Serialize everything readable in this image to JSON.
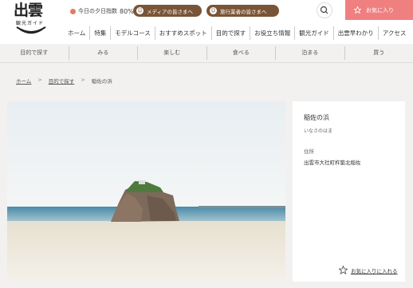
{
  "logo": {
    "main": "出雲",
    "sub": "観光ガイド"
  },
  "header": {
    "sunset_label": "今日の夕日指数",
    "sunset_value": "80%",
    "media_button": "メディアの皆さまへ",
    "travel_button": "旅行業者の皆さまへ",
    "favorites_button": "お気に入り"
  },
  "nav": {
    "items": [
      "ホーム",
      "特集",
      "モデルコース",
      "おすすめスポット",
      "目的で探す",
      "お役立ち情報",
      "観光ガイド",
      "出雲早わかり",
      "アクセス"
    ]
  },
  "subnav": {
    "items": [
      "目的で探す",
      "みる",
      "楽しむ",
      "食べる",
      "泊まる",
      "買う"
    ]
  },
  "breadcrumb": {
    "home": "ホーム",
    "category": "目的で探す",
    "current": "稲佐の浜"
  },
  "spot": {
    "name": "稲佐の浜",
    "kana": "いなさのはま",
    "address_label": "住所",
    "address": "出雲市大社町杵築北稲佐",
    "add_favorite": "お気に入りに入れる"
  },
  "icons": {
    "search": "search-icon",
    "favorite": "star-icon",
    "media": "face-icon",
    "travel": "face-icon"
  },
  "colors": {
    "accent_pink": "#f08080",
    "brown": "#7a5436",
    "sun": "#e07b66"
  }
}
